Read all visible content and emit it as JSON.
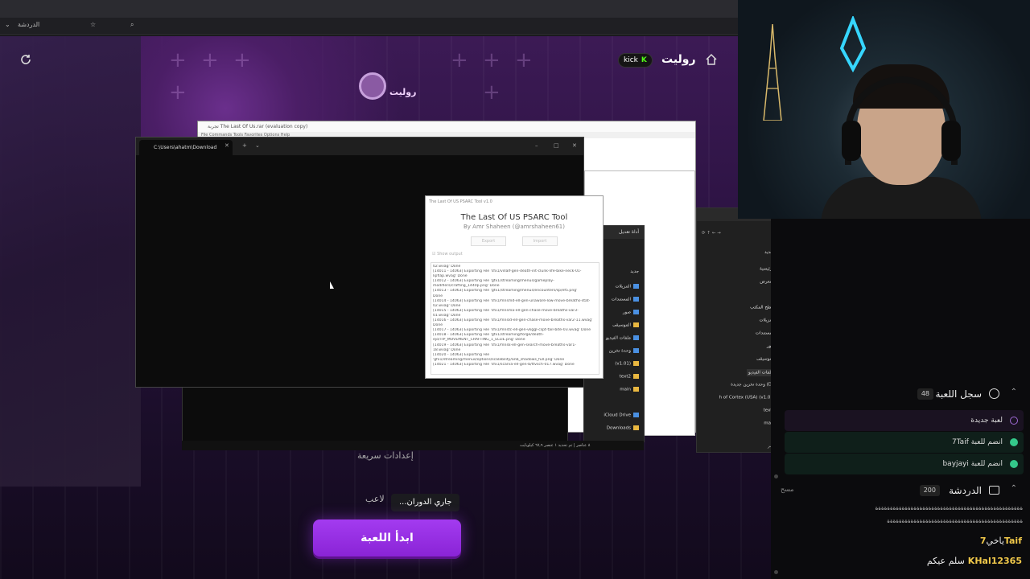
{
  "browser": {
    "tab_label": "الدردشة"
  },
  "page": {
    "title": "روليت",
    "kick_label": "kick",
    "logo_text": "روليت",
    "settings_label": "إعدادات سريعة",
    "players_label": "لاعب",
    "spinning_label": "...جاري الدوران",
    "start_button": "ابدأ اللعبة"
  },
  "back_window": {
    "title": "تجربة The Last Of Us.rar (evaluation copy)",
    "menu": "File   Commands   Tools   Favorites   Options   Help"
  },
  "terminal": {
    "tab_title": "C:\\Users\\ahatm\\Download",
    "status": "٨ عناصر | تم تحديد ١ عنصر  ٦٧,٩ كيلوبايت"
  },
  "psarc": {
    "window_title": "The Last Of US PSARC Tool v1.0",
    "title": "The Last Of US PSARC Tool",
    "byline": "By Amr Shaheen (@amrshaheen61)",
    "export_label": "Export",
    "import_label": "Import",
    "show_output_label": "Show output",
    "log_lines": [
      "02.wvag' Done",
      "[14011 - 14063] Exporting File 'sfx1/villalf-gen-death-int-clunk-life-bike-neck-01-",
      "lipflap.wvag' Done",
      "[14012 - 14063] Exporting File 'gfx1/streaming/menus/gameplay-",
      "modifiers/crafting_1440p.png' Done",
      "[14013 - 14063] Exporting File 'gfx1/streaming/menus/encounters/sp/ef5.png'",
      "Done",
      "[14014 - 14063] Exporting File 'sfx1/mnsmd-ell-gen-unaware-low-move-breaths-stat-",
      "02.wvag' Done",
      "[14015 - 14063] Exporting File 'sfx1/mnsma-ell-gen-chase-move-breaths-var3-",
      "01.wvag' Done",
      "[14016 - 14063] Exporting File 'sfx1/mnsld-ell-gen-chase-move-breaths-var2-11.wvag'",
      "Done",
      "[14017 - 14063] Exporting File 'sfx1/mnstc-ell-gen-vkggl-cspt-tail-bite-03.wvag' Done",
      "[14018 - 14063] Exporting File 'gfx1/streaming/forge/death-",
      "ejo/TIP_MOVEMENT_CRAFTING_1_ELLIE.png' Done",
      "[14019 - 14063] Exporting File 'sfx1/mnsk-ell-gen-search-move-breaths-var1-",
      "18.wvag' Done",
      "[14020 - 14063] Exporting File",
      "'gfx1/streaming/menus/options/scalability/anb_shadows_full.png' Done",
      "[14021 - 14063] Exporting File 'sfx1/scarva-ell-gen-b/ttvsch-017.wvag' Done"
    ]
  },
  "explorer": {
    "title": "التنزيلات",
    "mini_title": "أداة تعديل",
    "new_label": "جديد",
    "nav_items": [
      "الرئيسية",
      "المعرض",
      "سطح المكتب",
      "التنزيلات",
      "المستندات",
      "صور",
      "الموسيقى",
      "ملفات الفيديو",
      "وحدة تخزين جديدة (D:)",
      "h of Cortex (USA) (v1.01)",
      "text2",
      "main"
    ],
    "mini_items": [
      "التنزيلات",
      "المستندات",
      "صور",
      "الموسيقى",
      "ملفات الفيديو",
      "وحدة تخزين",
      "(v1.01)",
      "text2",
      "main",
      "iCloud Drive",
      "Downloads"
    ],
    "count_label": "٨ عناصر"
  },
  "game_log": {
    "title": "سجل اللعبة",
    "count": "48",
    "entries": [
      {
        "text": "لعبة جديدة"
      },
      {
        "text": "7Taif انضم للعبة"
      },
      {
        "text": "bayjayi انضم للعبة"
      }
    ]
  },
  "chat": {
    "title": "الدردشة",
    "count": "200",
    "clear_label": "مسح",
    "spam_1": "ةةةةةةةةةةةةةةةةةةةةةةةةةةةةةةةةةةةةةةةةةةةةةةةةةة",
    "spam_2": "ةةةةةةةةةةةةةةةةةةةةةةةةةةةةةةةةةةةةةةةةةةةةةة",
    "messages": [
      {
        "user": "7Taif",
        "text": "ياخي"
      },
      {
        "user": "KHal12365",
        "text": "سلم عيكم"
      }
    ]
  },
  "colors": {
    "accent_purple": "#9a30e6",
    "kick_green": "#53fc18",
    "chat_username": "#f1c94a",
    "join_green": "#34c88a"
  }
}
